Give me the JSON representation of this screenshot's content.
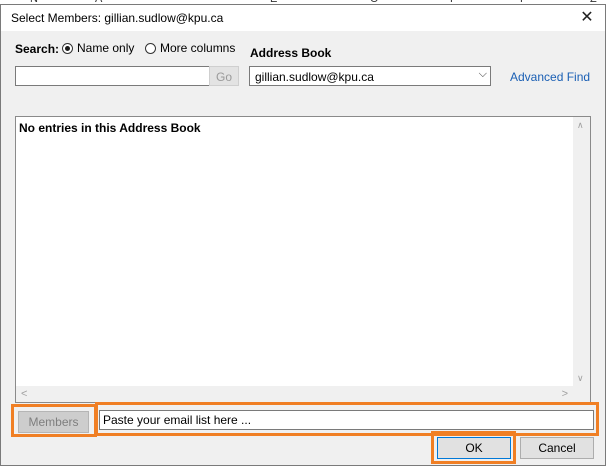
{
  "dialog": {
    "title": "Select Members: gillian.sudlow@kpu.ca",
    "close_symbol": "✕"
  },
  "search": {
    "label": "Search:",
    "options": [
      "Name only",
      "More columns"
    ],
    "selected": "Name only",
    "value": "",
    "go_label": "Go"
  },
  "address_book": {
    "label": "Address Book",
    "selected": "gillian.sudlow@kpu.ca",
    "advanced_find": "Advanced Find"
  },
  "results": {
    "empty_message": "No entries in this Address Book"
  },
  "members": {
    "button_label": "Members",
    "input_value": "Paste your email list here ..."
  },
  "buttons": {
    "ok": "OK",
    "cancel": "Cancel"
  },
  "colors": {
    "highlight": "#f07f24",
    "link": "#1a5fb4",
    "focus_border": "#0078d7"
  }
}
